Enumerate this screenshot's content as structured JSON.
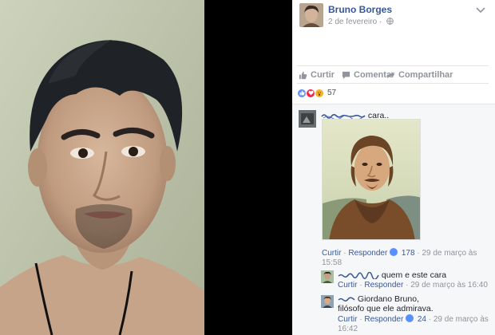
{
  "post": {
    "author": "Bruno Borges",
    "date": "2 de fevereiro",
    "date_separator": "·",
    "actions": {
      "like": "Curtir",
      "comment": "Comentar",
      "share": "Compartilhar"
    },
    "reactions": {
      "count": "57",
      "types": [
        "like",
        "love",
        "wow"
      ]
    }
  },
  "comments": [
    {
      "text": "cara..",
      "image": "giordano-bruno-portrait",
      "meta": {
        "like": "Curtir",
        "sep": "·",
        "reply": "Responder",
        "likes": "178",
        "time_a": "29 de março às",
        "time_b": "15:58"
      },
      "replies": [
        {
          "text": "quem e este cara",
          "meta": {
            "like": "Curtir",
            "sep": "·",
            "reply": "Responder",
            "time": "29 de março às 16:40"
          }
        },
        {
          "text_a": "Giordano Bruno,",
          "text_b": "filósofo que ele admirava.",
          "meta": {
            "like": "Curtir",
            "sep": "·",
            "reply": "Responder",
            "likes": "24",
            "time_a": "29 de março às",
            "time_b": "16:42"
          }
        }
      ]
    }
  ],
  "colors": {
    "brand_link": "#365899",
    "meta_grey": "#90949c",
    "like_blue": "#5890ff",
    "love_red": "#f0284a",
    "wow_yellow": "#f7b125"
  }
}
